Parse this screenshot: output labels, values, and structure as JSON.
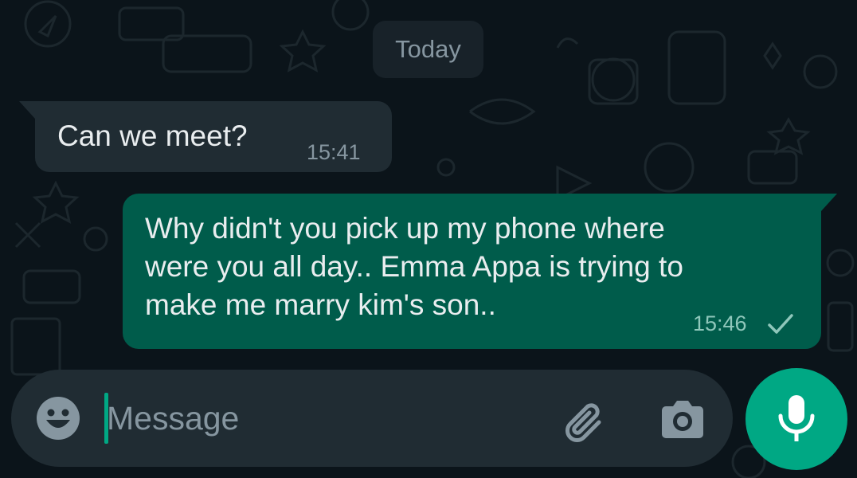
{
  "chat": {
    "date_separator": "Today",
    "messages": [
      {
        "direction": "incoming",
        "text": "Can we meet?",
        "time": "15:41"
      },
      {
        "direction": "outgoing",
        "text": "Why didn't you pick up my phone where\nwere you all day.. Emma Appa is trying to\nmake me marry kim's son..",
        "time": "15:46",
        "status": "sent"
      }
    ]
  },
  "composer": {
    "placeholder": "Message",
    "value": "",
    "icons": [
      "emoji-icon",
      "attach-icon",
      "camera-icon",
      "microphone-icon"
    ]
  },
  "colors": {
    "background": "#0b141a",
    "incoming_bubble": "#202c33",
    "outgoing_bubble": "#005c4b",
    "accent": "#00a884",
    "secondary_text": "#8696a0"
  }
}
